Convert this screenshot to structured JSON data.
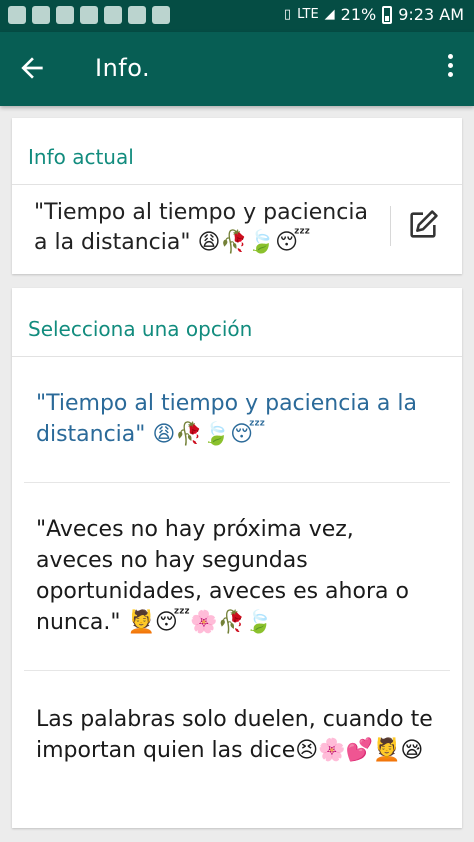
{
  "status_bar": {
    "battery": "21%",
    "time": "9:23 AM",
    "network": "LTE"
  },
  "app_bar": {
    "title": "Info."
  },
  "current": {
    "header": "Info actual",
    "text": "\"Tiempo al tiempo y paciencia a la distancia\" 😩🥀🍃😴"
  },
  "options": {
    "header": "Selecciona una opción",
    "items": [
      {
        "text": "\"Tiempo al tiempo y paciencia a la distancia\" 😩🥀🍃😴",
        "selected": true
      },
      {
        "text": "\"Aveces no hay próxima vez, aveces no hay segundas oportunidades, aveces es ahora o nunca.\" 💆😴🌸🥀🍃",
        "selected": false
      },
      {
        "text": "Las palabras solo duelen, cuando te importan quien las dice😣🌸💕💆😪",
        "selected": false
      }
    ]
  },
  "colors": {
    "status_bar": "#054d44",
    "app_bar": "#075e54",
    "accent": "#128c7e",
    "selected_text": "#2b6a99"
  }
}
